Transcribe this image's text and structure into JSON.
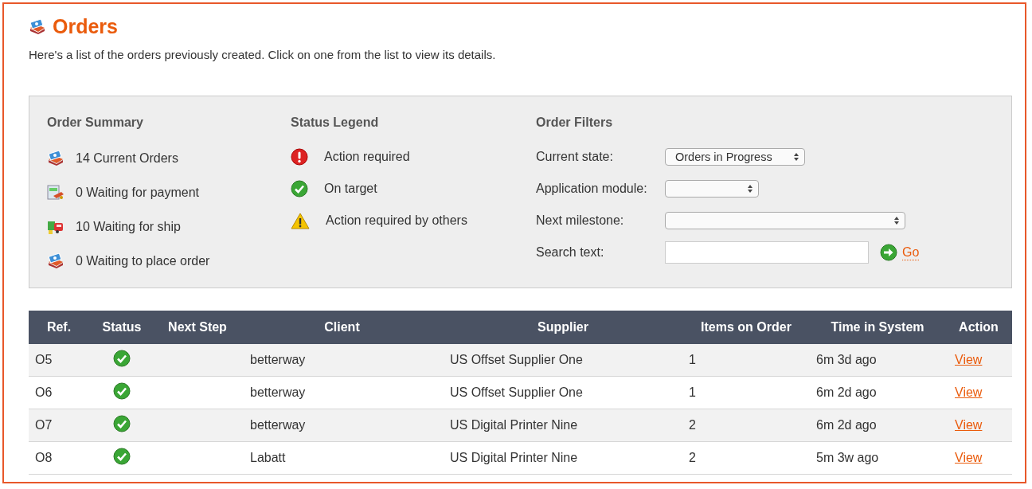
{
  "page": {
    "title": "Orders",
    "intro": "Here's a list of the orders previously created. Click on one from the list to view its details."
  },
  "summary": {
    "title": "Order Summary",
    "items": [
      {
        "kind": "orders",
        "label": "14 Current Orders"
      },
      {
        "kind": "payment",
        "label": "0 Waiting for payment"
      },
      {
        "kind": "ship",
        "label": "10 Waiting for ship"
      },
      {
        "kind": "orders",
        "label": "0 Waiting to place order"
      }
    ]
  },
  "legend": {
    "title": "Status Legend",
    "items": [
      {
        "kind": "action_required",
        "label": "Action required"
      },
      {
        "kind": "on_target",
        "label": "On target"
      },
      {
        "kind": "warning",
        "label": "Action required by others"
      }
    ]
  },
  "filters": {
    "title": "Order Filters",
    "fields": [
      {
        "kind": "select",
        "label": "Current state:",
        "value": "Orders in Progress"
      },
      {
        "kind": "select",
        "label": "Application module:"
      },
      {
        "kind": "select",
        "label": "Next milestone:"
      },
      {
        "kind": "text",
        "label": "Search text:",
        "action": "Go"
      }
    ]
  },
  "table": {
    "columns": [
      "Ref.",
      "Status",
      "Next Step",
      "Client",
      "Supplier",
      "Items on Order",
      "Time in System",
      "Action"
    ],
    "rows": [
      {
        "ref": "O5",
        "kind": "on_target",
        "client": "betterway",
        "supplier": "US Offset Supplier One",
        "items": "1",
        "time": "6m 3d ago",
        "action": "View"
      },
      {
        "ref": "O6",
        "kind": "on_target",
        "client": "betterway",
        "supplier": "US Offset Supplier One",
        "items": "1",
        "time": "6m 2d ago",
        "action": "View"
      },
      {
        "ref": "O7",
        "kind": "on_target",
        "client": "betterway",
        "supplier": "US Digital Printer Nine",
        "items": "2",
        "time": "6m 2d ago",
        "action": "View"
      },
      {
        "ref": "O8",
        "kind": "on_target",
        "client": "Labatt",
        "supplier": "US Digital Printer Nine",
        "items": "2",
        "time": "5m 3w ago",
        "action": "View"
      }
    ]
  }
}
